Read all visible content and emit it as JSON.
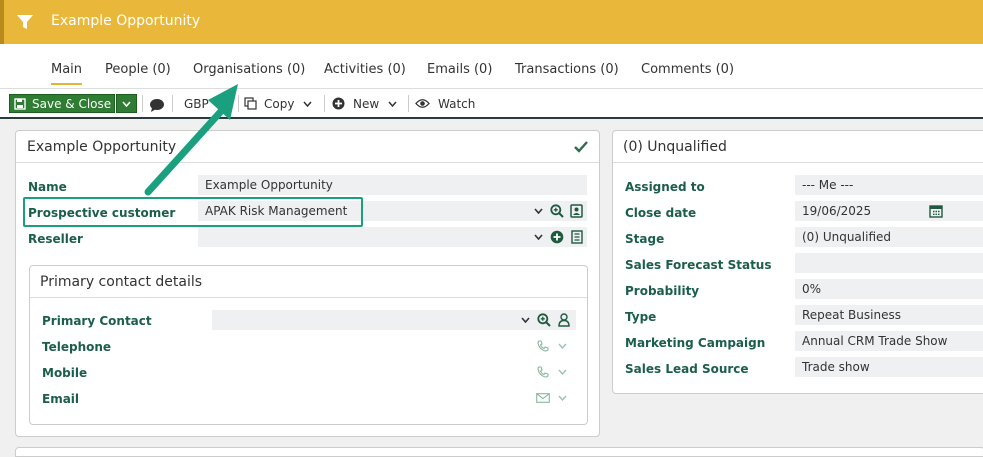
{
  "header": {
    "title": "Example Opportunity"
  },
  "tabs": [
    {
      "label": "Main"
    },
    {
      "label": "People (0)"
    },
    {
      "label": "Organisations (0)"
    },
    {
      "label": "Activities (0)"
    },
    {
      "label": "Emails (0)"
    },
    {
      "label": "Transactions (0)"
    },
    {
      "label": "Comments (0)"
    }
  ],
  "toolbar": {
    "save_close": "Save & Close",
    "currency": "GBP",
    "copy": "Copy",
    "new": "New",
    "watch": "Watch"
  },
  "left_panel": {
    "title": "Example Opportunity",
    "fields": [
      {
        "label": "Name",
        "value": "Example Opportunity"
      },
      {
        "label": "Prospective customer",
        "value": "APAK Risk Management"
      },
      {
        "label": "Reseller",
        "value": ""
      }
    ],
    "contact": {
      "title": "Primary contact details",
      "fields": [
        {
          "label": "Primary Contact",
          "value": ""
        },
        {
          "label": "Telephone"
        },
        {
          "label": "Mobile"
        },
        {
          "label": "Email"
        }
      ]
    }
  },
  "right_panel": {
    "title": "(0) Unqualified",
    "fields": [
      {
        "label": "Assigned to",
        "value": "--- Me ---"
      },
      {
        "label": "Close date",
        "value": "19/06/2025"
      },
      {
        "label": "Stage",
        "value": "(0) Unqualified"
      },
      {
        "label": "Sales Forecast Status",
        "value": ""
      },
      {
        "label": "Probability",
        "value": "0%"
      },
      {
        "label": "Type",
        "value": "Repeat Business"
      },
      {
        "label": "Marketing Campaign",
        "value": "Annual CRM Trade Show"
      },
      {
        "label": "Sales Lead Source",
        "value": "Trade show"
      }
    ]
  },
  "colors": {
    "accent": "#e9b83a",
    "label_green": "#1b5e4b",
    "save_green": "#2e7d32",
    "callout": "#1aa07f"
  }
}
